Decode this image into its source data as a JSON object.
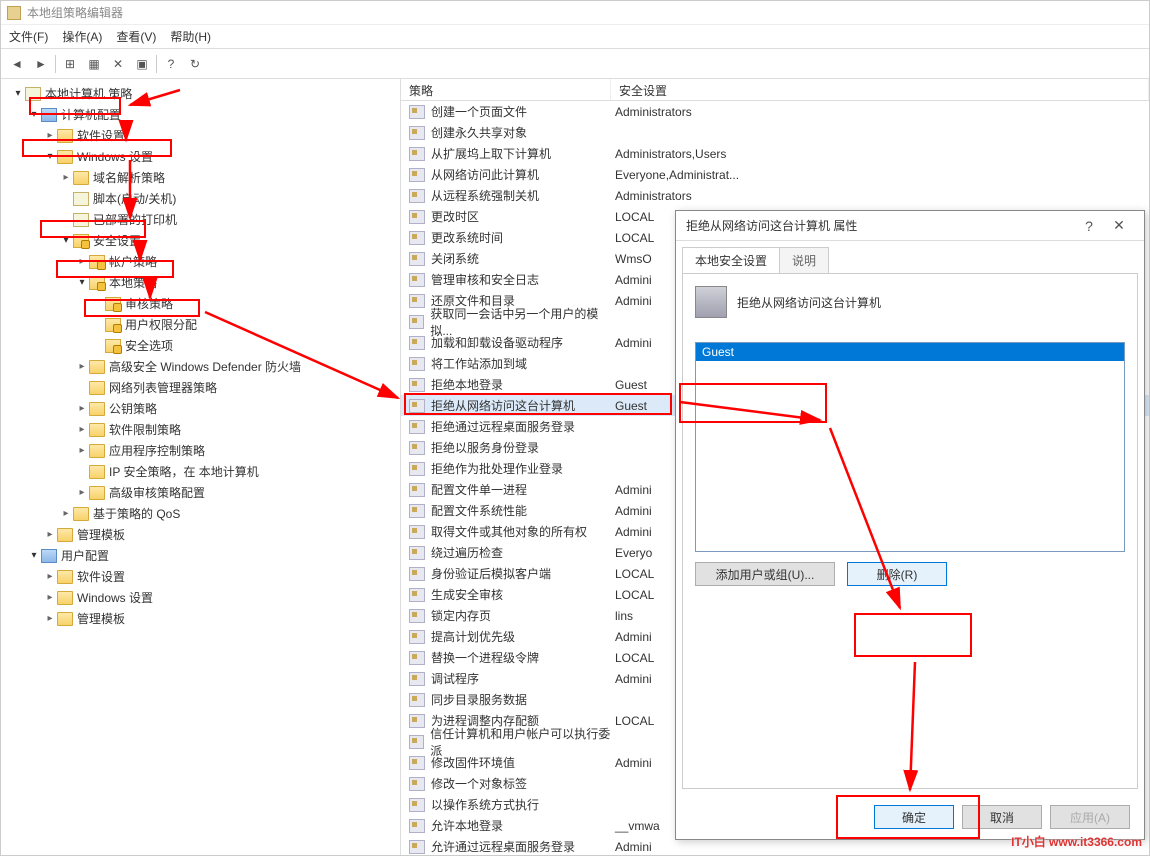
{
  "window": {
    "title": "本地组策略编辑器"
  },
  "menu": {
    "file": "文件(F)",
    "action": "操作(A)",
    "view": "查看(V)",
    "help": "帮助(H)"
  },
  "tree": {
    "root": "本地计算机 策略",
    "computer_config": "计算机配置",
    "software_settings": "软件设置",
    "windows_settings": "Windows 设置",
    "dns_policy": "域名解析策略",
    "scripts": "脚本(启动/关机)",
    "deployed_printers": "已部署的打印机",
    "security_settings": "安全设置",
    "account_policies": "帐户策略",
    "local_policies": "本地策略",
    "audit_policy": "审核策略",
    "user_rights": "用户权限分配",
    "security_options": "安全选项",
    "defender_fw": "高级安全 Windows Defender 防火墙",
    "nlm": "网络列表管理器策略",
    "public_key": "公钥策略",
    "software_restrict": "软件限制策略",
    "app_control": "应用程序控制策略",
    "ipsec": "IP 安全策略，在 本地计算机",
    "adv_audit": "高级审核策略配置",
    "qos": "基于策略的 QoS",
    "admin_templates": "管理模板",
    "user_config": "用户配置",
    "u_software": "软件设置",
    "u_windows": "Windows 设置",
    "u_admin": "管理模板"
  },
  "list": {
    "col_policy": "策略",
    "col_setting": "安全设置",
    "rows": [
      {
        "name": "创建一个页面文件",
        "value": "Administrators"
      },
      {
        "name": "创建永久共享对象",
        "value": ""
      },
      {
        "name": "从扩展坞上取下计算机",
        "value": "Administrators,Users"
      },
      {
        "name": "从网络访问此计算机",
        "value": "Everyone,Administrat..."
      },
      {
        "name": "从远程系统强制关机",
        "value": "Administrators"
      },
      {
        "name": "更改时区",
        "value": "LOCAL"
      },
      {
        "name": "更改系统时间",
        "value": "LOCAL"
      },
      {
        "name": "关闭系统",
        "value": "WmsO"
      },
      {
        "name": "管理审核和安全日志",
        "value": "Admini"
      },
      {
        "name": "还原文件和目录",
        "value": "Admini"
      },
      {
        "name": "获取同一会话中另一个用户的模拟...",
        "value": ""
      },
      {
        "name": "加载和卸载设备驱动程序",
        "value": "Admini"
      },
      {
        "name": "将工作站添加到域",
        "value": ""
      },
      {
        "name": "拒绝本地登录",
        "value": "Guest"
      },
      {
        "name": "拒绝从网络访问这台计算机",
        "value": "Guest",
        "selected": true
      },
      {
        "name": "拒绝通过远程桌面服务登录",
        "value": ""
      },
      {
        "name": "拒绝以服务身份登录",
        "value": ""
      },
      {
        "name": "拒绝作为批处理作业登录",
        "value": ""
      },
      {
        "name": "配置文件单一进程",
        "value": "Admini"
      },
      {
        "name": "配置文件系统性能",
        "value": "Admini"
      },
      {
        "name": "取得文件或其他对象的所有权",
        "value": "Admini"
      },
      {
        "name": "绕过遍历检查",
        "value": "Everyo"
      },
      {
        "name": "身份验证后模拟客户端",
        "value": "LOCAL"
      },
      {
        "name": "生成安全审核",
        "value": "LOCAL"
      },
      {
        "name": "锁定内存页",
        "value": "lins"
      },
      {
        "name": "提高计划优先级",
        "value": "Admini"
      },
      {
        "name": "替换一个进程级令牌",
        "value": "LOCAL"
      },
      {
        "name": "调试程序",
        "value": "Admini"
      },
      {
        "name": "同步目录服务数据",
        "value": ""
      },
      {
        "name": "为进程调整内存配额",
        "value": "LOCAL"
      },
      {
        "name": "信任计算机和用户帐户可以执行委派",
        "value": ""
      },
      {
        "name": "修改固件环境值",
        "value": "Admini"
      },
      {
        "name": "修改一个对象标签",
        "value": ""
      },
      {
        "name": "以操作系统方式执行",
        "value": ""
      },
      {
        "name": "允许本地登录",
        "value": "__vmwa"
      },
      {
        "name": "允许通过远程桌面服务登录",
        "value": "Admini"
      }
    ]
  },
  "dialog": {
    "title": "拒绝从网络访问这台计算机 属性",
    "help": "?",
    "close": "✕",
    "tab_local": "本地安全设置",
    "tab_explain": "说明",
    "policy_name": "拒绝从网络访问这台计算机",
    "listbox_item": "Guest",
    "btn_add": "添加用户或组(U)...",
    "btn_remove": "删除(R)",
    "btn_ok": "确定",
    "btn_cancel": "取消",
    "btn_apply": "应用(A)"
  },
  "watermark": "IT小白  www.it3366.com"
}
